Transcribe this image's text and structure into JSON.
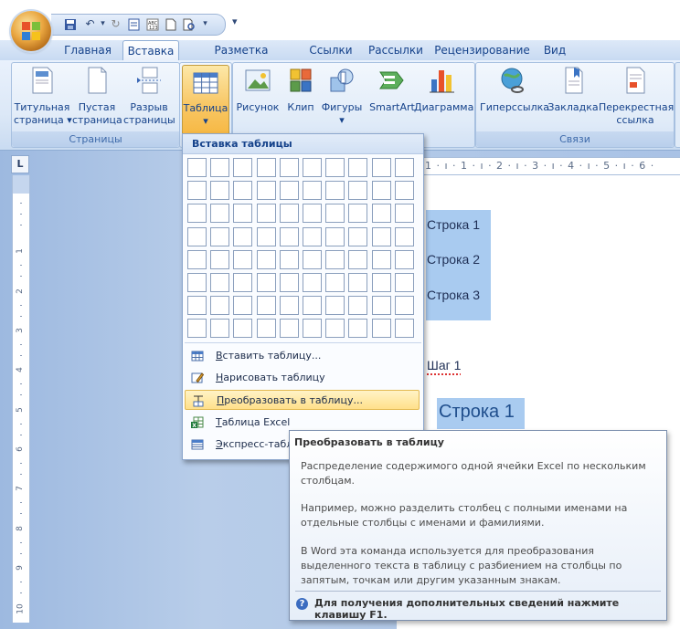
{
  "qat": {
    "dropdown_glyph": "▾"
  },
  "tabs": [
    "Главная",
    "Вставка",
    "Разметка страницы",
    "Ссылки",
    "Рассылки",
    "Рецензирование",
    "Вид"
  ],
  "active_tab": "Вставка",
  "ribbon": {
    "groups": [
      {
        "label": "Страницы",
        "buttons": [
          {
            "line1": "Титульная",
            "line2": "страница ▾",
            "icon": "cover-page-icon"
          },
          {
            "line1": "Пустая",
            "line2": "страница",
            "icon": "blank-page-icon"
          },
          {
            "line1": "Разрыв",
            "line2": "страницы",
            "icon": "page-break-icon"
          }
        ]
      },
      {
        "label": "",
        "buttons": [
          {
            "line1": "Таблица",
            "line2": "▾",
            "icon": "table-icon"
          }
        ]
      },
      {
        "label": "",
        "buttons": [
          {
            "line1": "Рисунок",
            "icon": "picture-icon"
          },
          {
            "line1": "Клип",
            "icon": "clipart-icon"
          },
          {
            "line1": "Фигуры",
            "line2": "▾",
            "icon": "shapes-icon"
          },
          {
            "line1": "SmartArt",
            "icon": "smartart-icon"
          },
          {
            "line1": "Диаграмма",
            "icon": "chart-icon"
          }
        ]
      },
      {
        "label": "Связи",
        "buttons": [
          {
            "line1": "Гиперссылка",
            "icon": "hyperlink-icon"
          },
          {
            "line1": "Закладка",
            "icon": "bookmark-icon"
          },
          {
            "line1": "Перекрестная",
            "line2": "ссылка",
            "icon": "cross-reference-icon"
          }
        ]
      }
    ]
  },
  "ruler": {
    "corner_glyph": "L",
    "h_text": "· 1 · ı · 1 · ı · 2 · ı · 3 · ı · 4 · ı · 5 · ı · 6 ·",
    "v_numbers": [
      "1",
      "2",
      "3",
      "4",
      "5",
      "6",
      "7",
      "8",
      "9",
      "10"
    ]
  },
  "document": {
    "rows": [
      "Строка 1",
      "Строка 2",
      "Строка 3"
    ],
    "step": "Шаг 1",
    "big_row": "Строка 1"
  },
  "dropdown": {
    "title": "Вставка таблицы",
    "grid": {
      "cols": 10,
      "rows": 8
    },
    "items": [
      {
        "label_u": "В",
        "label_rest": "ставить таблицу...",
        "icon": "insert-table-icon"
      },
      {
        "label_u": "Н",
        "label_rest": "арисовать таблицу",
        "icon": "draw-table-icon"
      },
      {
        "label_u": "П",
        "label_rest": "реобразовать в таблицу...",
        "icon": "convert-text-icon",
        "highlighted": true
      },
      {
        "label_u": "Т",
        "label_rest": "аблица Excel",
        "icon": "excel-table-icon"
      },
      {
        "label_u": "Э",
        "label_rest": "кспресс-табл",
        "icon": "quick-tables-icon"
      }
    ]
  },
  "tooltip": {
    "title": "Преобразовать в таблицу",
    "p1": "Распределение содержимого одной ячейки Excel по нескольким столбцам.",
    "p2": "Например, можно разделить столбец с полными именами на отдельные столбцы с именами и фамилиями.",
    "p3": "В Word эта команда используется для преобразования выделенного текста в таблицу с разбиением на столбцы по запятым, точкам или другим указанным знакам.",
    "help": "Для получения дополнительных сведений нажмите клавишу F1."
  },
  "colors": {
    "ribbon_blue": "#15428b",
    "selection": "#a9cbf0",
    "highlight": "#ffe08a"
  }
}
